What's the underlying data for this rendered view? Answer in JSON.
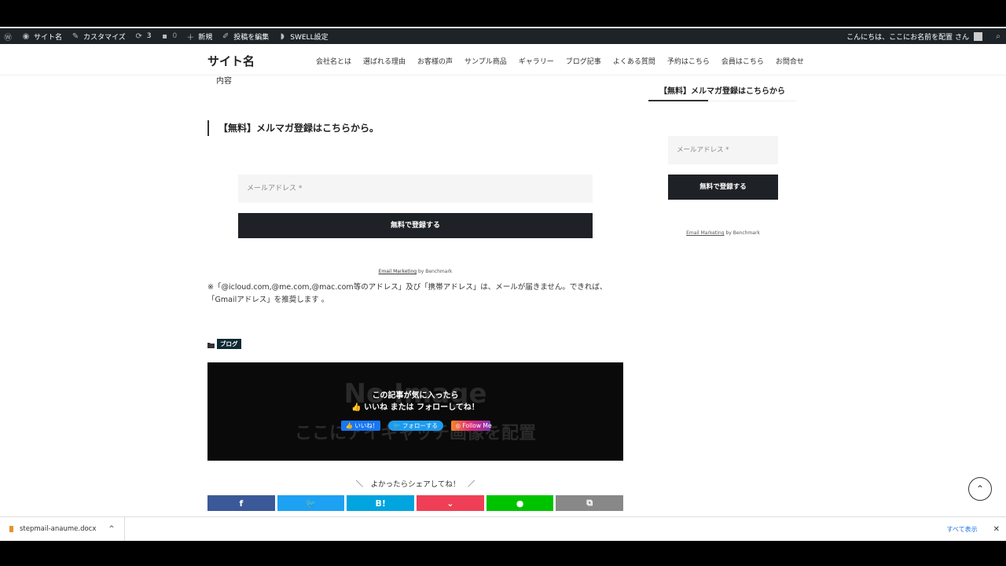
{
  "admin_bar": {
    "site_name": "サイト名",
    "customize": "カスタマイズ",
    "updates": "3",
    "comments": "0",
    "new": "新規",
    "edit_post": "投稿を編集",
    "swell": "SWELL設定",
    "greeting": "こんにちは、ここにお名前を配置 さん"
  },
  "header": {
    "logo": "サイト名",
    "nav": [
      "会社名とは",
      "選ばれる理由",
      "お客様の声",
      "サンプル商品",
      "ギャラリー",
      "ブログ記事",
      "よくある質問",
      "予約はこちら",
      "会員はこちら",
      "お問合せ"
    ]
  },
  "main": {
    "content_label": "内容",
    "heading": "【無料】メルマガ登録はこちらから。",
    "email_placeholder": "メールアドレス *",
    "submit": "無料で登録する",
    "bm_link": "Email Marketing",
    "bm_by": " by Benchmark",
    "note": "※「@icloud.com,@me.com,@mac.com等のアドレス」及び「携帯アドレス」は、メールが届きません。できれば、「Gmailアドレス」を推奨します 。",
    "category": "ブログ",
    "follow": {
      "bg_line1": "No Image",
      "bg_line2": "ここにアイキャッチ画像を配置",
      "line1": "この記事が気に入ったら",
      "line2": "いいね または フォローしてね！",
      "fb": "いいね！",
      "tw": "フォローする",
      "ig": "Follow Me"
    },
    "share_label": "＼　よかったらシェアしてね！　／",
    "share_buttons": [
      {
        "name": "facebook",
        "glyph": "f",
        "color": "#3b5998"
      },
      {
        "name": "twitter",
        "glyph": "🐦",
        "color": "#1da1f2"
      },
      {
        "name": "hatena",
        "glyph": "B!",
        "color": "#00a4de"
      },
      {
        "name": "pocket",
        "glyph": "⌄",
        "color": "#ef3f56"
      },
      {
        "name": "line",
        "glyph": "●",
        "color": "#00c300"
      },
      {
        "name": "copy",
        "glyph": "⧉",
        "color": "#888888"
      }
    ]
  },
  "sidebar": {
    "title": "【無料】メルマガ登録はこちらから",
    "email_placeholder": "メールアドレス *",
    "submit": "無料で登録する",
    "bm_link": "Email Marketing",
    "bm_by": " by Benchmark"
  },
  "download_bar": {
    "file": "stepmail-anaume.docx",
    "show_all": "すべて表示",
    "close": "✕"
  }
}
